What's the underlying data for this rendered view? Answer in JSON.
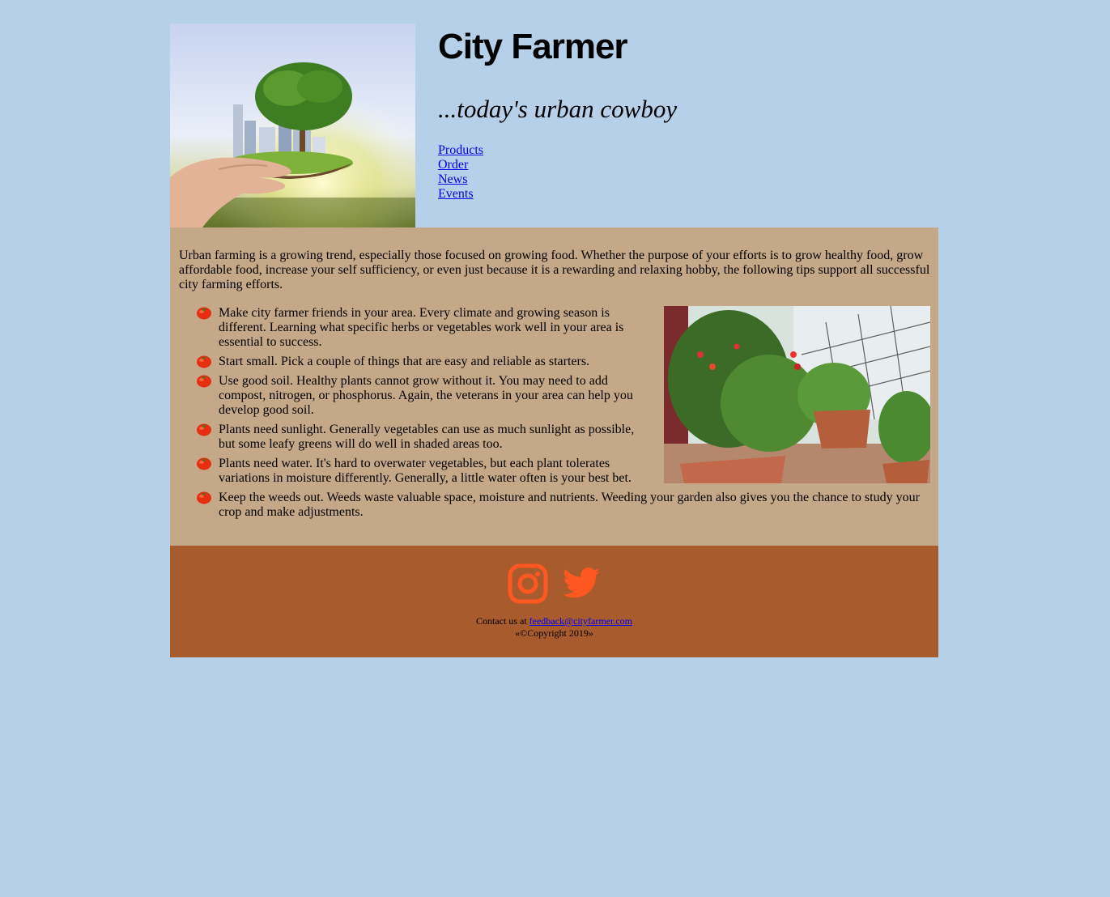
{
  "header": {
    "title": "City Farmer",
    "tagline": "...today's urban cowboy",
    "nav": [
      {
        "label": "Products"
      },
      {
        "label": "Order"
      },
      {
        "label": "News"
      },
      {
        "label": "Events"
      }
    ]
  },
  "main": {
    "intro": "Urban farming is a growing trend, especially those focused on growing food. Whether the purpose of your efforts is to grow healthy food, grow affordable food, increase your self sufficiency, or even just because it is a rewarding and relaxing hobby, the following tips support all successful city farming efforts.",
    "tips": [
      "Make city farmer friends in your area. Every climate and growing season is different. Learning what specific herbs or vegetables work well in your area is essential to success.",
      "Start small. Pick a couple of things that are easy and reliable as starters.",
      "Use good soil. Healthy plants cannot grow without it. You may need to add compost, nitrogen, or phosphorus. Again, the veterans in your area can help you develop good soil.",
      "Plants need sunlight. Generally vegetables can use as much sunlight as possible, but some leafy greens will do well in shaded areas too.",
      "Plants need water. It's hard to overwater vegetables, but each plant tolerates variations in moisture differently. Generally, a little water often is your best bet.",
      "Keep the weeds out. Weeds waste valuable space, moisture and nutrients. Weeding your garden also gives you the chance to study your crop and make adjustments."
    ]
  },
  "footer": {
    "contact_prefix": "Contact us at ",
    "email": "feedback@cityfarmer.com",
    "copyright": "«©Copyright 2019»",
    "icons": [
      "instagram-icon",
      "twitter-icon"
    ]
  },
  "colors": {
    "background": "#b7d0e9",
    "main": "#c4a888",
    "footer": "#a85b2c",
    "social_icon": "#ff5722"
  }
}
